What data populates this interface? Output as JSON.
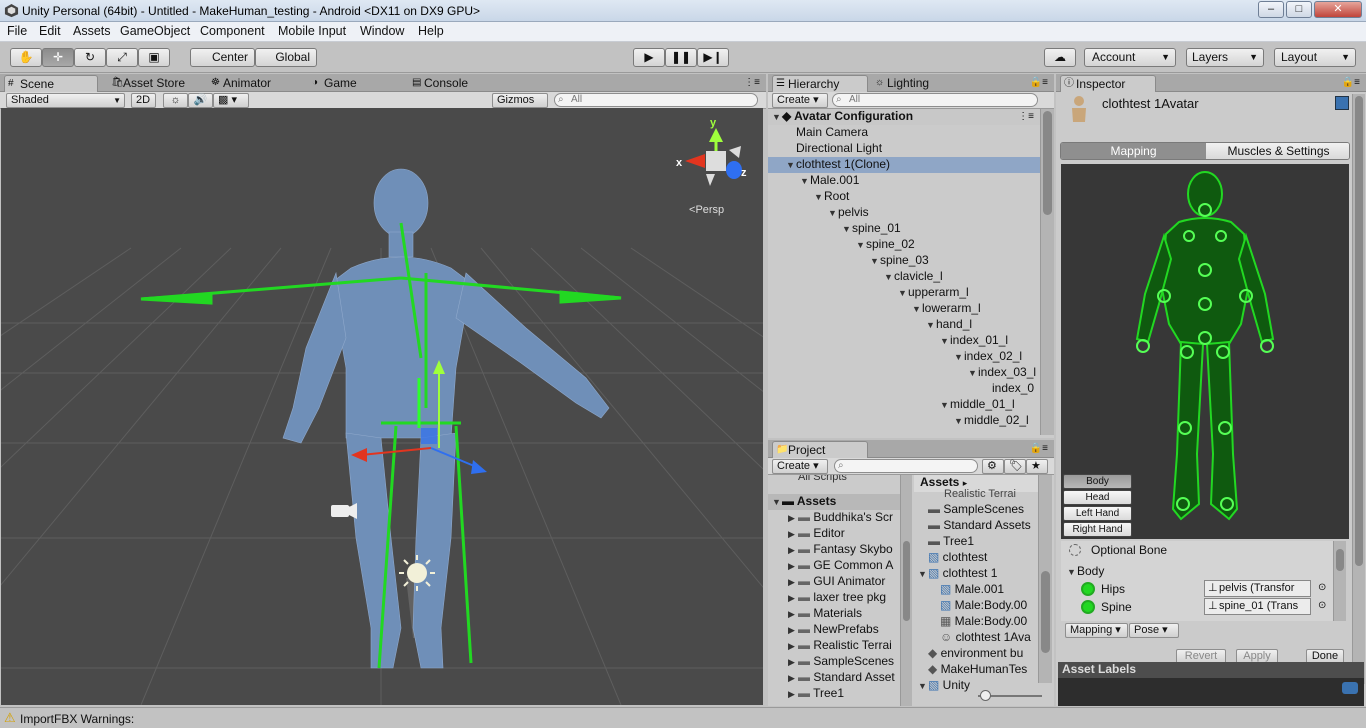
{
  "window": {
    "title": "Unity Personal (64bit) - Untitled - MakeHuman_testing - Android <DX11 on DX9 GPU>"
  },
  "menu": [
    "File",
    "Edit",
    "Assets",
    "GameObject",
    "Component",
    "Mobile Input",
    "Window",
    "Help"
  ],
  "toolbar": {
    "pivot": "Center",
    "space": "Global",
    "account": "Account",
    "layers": "Layers",
    "layout": "Layout"
  },
  "scene": {
    "tabs": [
      "Scene",
      "Asset Store",
      "Animator",
      "Game",
      "Console"
    ],
    "shading": "Shaded",
    "mode2d": "2D",
    "gizmos": "Gizmos",
    "search": "All",
    "persp": "Persp",
    "axis_x": "x",
    "axis_y": "y",
    "axis_z": "z"
  },
  "hierarchy": {
    "tabs": [
      "Hierarchy",
      "Lighting"
    ],
    "create": "Create",
    "search": "All",
    "root": "Avatar Configuration",
    "items": [
      {
        "label": "Main Camera",
        "d": 0,
        "tri": false
      },
      {
        "label": "Directional Light",
        "d": 0,
        "tri": false
      },
      {
        "label": "clothtest 1(Clone)",
        "d": 0,
        "tri": true,
        "sel": true
      },
      {
        "label": "Male.001",
        "d": 1,
        "tri": true
      },
      {
        "label": "Root",
        "d": 2,
        "tri": true
      },
      {
        "label": "pelvis",
        "d": 3,
        "tri": true
      },
      {
        "label": "spine_01",
        "d": 4,
        "tri": true
      },
      {
        "label": "spine_02",
        "d": 5,
        "tri": true
      },
      {
        "label": "spine_03",
        "d": 6,
        "tri": true
      },
      {
        "label": "clavicle_l",
        "d": 7,
        "tri": true
      },
      {
        "label": "upperarm_l",
        "d": 8,
        "tri": true
      },
      {
        "label": "lowerarm_l",
        "d": 9,
        "tri": true
      },
      {
        "label": "hand_l",
        "d": 10,
        "tri": true
      },
      {
        "label": "index_01_l",
        "d": 11,
        "tri": true
      },
      {
        "label": "index_02_l",
        "d": 12,
        "tri": true
      },
      {
        "label": "index_03_l",
        "d": 13,
        "tri": true
      },
      {
        "label": "index_0",
        "d": 14,
        "tri": false
      },
      {
        "label": "middle_01_l",
        "d": 11,
        "tri": true
      },
      {
        "label": "middle_02_l",
        "d": 12,
        "tri": true
      }
    ]
  },
  "project": {
    "tab": "Project",
    "create": "Create",
    "root": "Assets",
    "cut_top": "All Scripts",
    "folders": [
      "Buddhika's Scr",
      "Editor",
      "Fantasy Skybo",
      "GE Common A",
      "GUI Animator",
      "laxer tree pkg",
      "Materials",
      "NewPrefabs",
      "Realistic Terrai",
      "SampleScenes",
      "Standard Asset",
      "Tree1"
    ],
    "crumb": "Assets",
    "assets_cut": "Realistic Terrai",
    "assets": [
      {
        "label": "SampleScenes",
        "d": 0,
        "k": "folder"
      },
      {
        "label": "Standard Assets",
        "d": 0,
        "k": "folder"
      },
      {
        "label": "Tree1",
        "d": 0,
        "k": "folder"
      },
      {
        "label": "clothtest",
        "d": 0,
        "k": "cube"
      },
      {
        "label": "clothtest 1",
        "d": 0,
        "k": "cube",
        "tri": true
      },
      {
        "label": "Male.001",
        "d": 1,
        "k": "cube"
      },
      {
        "label": "Male:Body.00",
        "d": 1,
        "k": "cube"
      },
      {
        "label": "Male:Body.00",
        "d": 1,
        "k": "grid"
      },
      {
        "label": "clothtest 1Ava",
        "d": 1,
        "k": "avatar"
      },
      {
        "label": "environment bu",
        "d": 0,
        "k": "unity"
      },
      {
        "label": "MakeHumanTes",
        "d": 0,
        "k": "unity"
      },
      {
        "label": "Unity",
        "d": 0,
        "k": "cube",
        "tri": true
      }
    ]
  },
  "inspector": {
    "tab": "Inspector",
    "title": "clothtest 1Avatar",
    "tabs": [
      "Mapping",
      "Muscles & Settings"
    ],
    "body_buttons": [
      "Body",
      "Head",
      "Left Hand",
      "Right Hand"
    ],
    "optional": "Optional Bone",
    "section": "Body",
    "rows": [
      {
        "label": "Hips",
        "value": "pelvis (Transfor"
      },
      {
        "label": "Spine",
        "value": "spine_01 (Trans"
      }
    ],
    "mapping": "Mapping",
    "pose": "Pose",
    "revert": "Revert",
    "apply": "Apply",
    "done": "Done",
    "asset_labels": "Asset Labels"
  },
  "status": {
    "text": "ImportFBX Warnings:"
  },
  "colors": {
    "accent": "#3a72b0",
    "bone": "#22d822",
    "mesh": "#6f8fb8",
    "select": "#8fa6c6"
  }
}
